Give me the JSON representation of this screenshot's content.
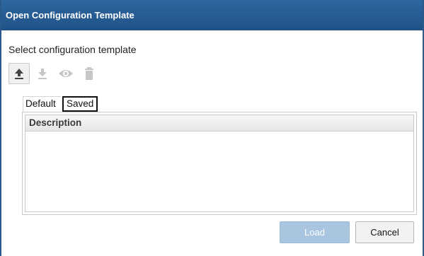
{
  "dialog": {
    "title": "Open Configuration Template",
    "subtitle": "Select configuration template"
  },
  "toolbar": {
    "buttons": [
      {
        "icon": "upload-icon",
        "enabled": true
      },
      {
        "icon": "download-icon",
        "enabled": false
      },
      {
        "icon": "eye-icon",
        "enabled": false
      },
      {
        "icon": "trash-icon",
        "enabled": false
      }
    ]
  },
  "tabs": [
    {
      "label": "Default"
    },
    {
      "label": "Saved",
      "selected": true
    }
  ],
  "grid": {
    "columns": [
      "Description"
    ],
    "rows": []
  },
  "actions": {
    "load_label": "Load",
    "cancel_label": "Cancel"
  },
  "colors": {
    "titlebar": "#1f5287",
    "load_disabled": "#a9c5e0",
    "icon_enabled": "#444444",
    "icon_disabled": "#c6c6c6"
  }
}
